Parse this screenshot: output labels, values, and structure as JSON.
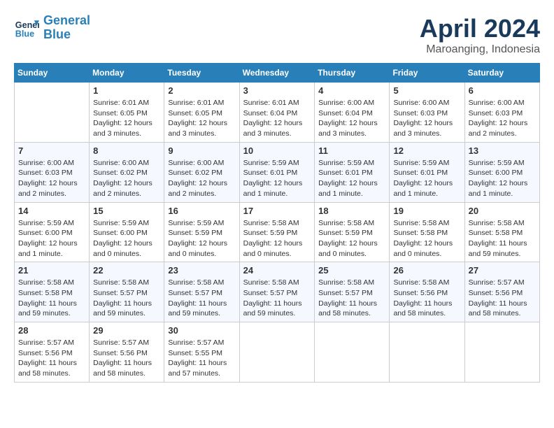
{
  "header": {
    "logo_line1": "General",
    "logo_line2": "Blue",
    "month": "April 2024",
    "location": "Maroanging, Indonesia"
  },
  "weekdays": [
    "Sunday",
    "Monday",
    "Tuesday",
    "Wednesday",
    "Thursday",
    "Friday",
    "Saturday"
  ],
  "weeks": [
    [
      {
        "day": "",
        "empty": true
      },
      {
        "day": "1",
        "sunrise": "6:01 AM",
        "sunset": "6:05 PM",
        "daylight": "12 hours and 3 minutes."
      },
      {
        "day": "2",
        "sunrise": "6:01 AM",
        "sunset": "6:05 PM",
        "daylight": "12 hours and 3 minutes."
      },
      {
        "day": "3",
        "sunrise": "6:01 AM",
        "sunset": "6:04 PM",
        "daylight": "12 hours and 3 minutes."
      },
      {
        "day": "4",
        "sunrise": "6:00 AM",
        "sunset": "6:04 PM",
        "daylight": "12 hours and 3 minutes."
      },
      {
        "day": "5",
        "sunrise": "6:00 AM",
        "sunset": "6:03 PM",
        "daylight": "12 hours and 3 minutes."
      },
      {
        "day": "6",
        "sunrise": "6:00 AM",
        "sunset": "6:03 PM",
        "daylight": "12 hours and 2 minutes."
      }
    ],
    [
      {
        "day": "7",
        "sunrise": "6:00 AM",
        "sunset": "6:03 PM",
        "daylight": "12 hours and 2 minutes."
      },
      {
        "day": "8",
        "sunrise": "6:00 AM",
        "sunset": "6:02 PM",
        "daylight": "12 hours and 2 minutes."
      },
      {
        "day": "9",
        "sunrise": "6:00 AM",
        "sunset": "6:02 PM",
        "daylight": "12 hours and 2 minutes."
      },
      {
        "day": "10",
        "sunrise": "5:59 AM",
        "sunset": "6:01 PM",
        "daylight": "12 hours and 1 minute."
      },
      {
        "day": "11",
        "sunrise": "5:59 AM",
        "sunset": "6:01 PM",
        "daylight": "12 hours and 1 minute."
      },
      {
        "day": "12",
        "sunrise": "5:59 AM",
        "sunset": "6:01 PM",
        "daylight": "12 hours and 1 minute."
      },
      {
        "day": "13",
        "sunrise": "5:59 AM",
        "sunset": "6:00 PM",
        "daylight": "12 hours and 1 minute."
      }
    ],
    [
      {
        "day": "14",
        "sunrise": "5:59 AM",
        "sunset": "6:00 PM",
        "daylight": "12 hours and 1 minute."
      },
      {
        "day": "15",
        "sunrise": "5:59 AM",
        "sunset": "6:00 PM",
        "daylight": "12 hours and 0 minutes."
      },
      {
        "day": "16",
        "sunrise": "5:59 AM",
        "sunset": "5:59 PM",
        "daylight": "12 hours and 0 minutes."
      },
      {
        "day": "17",
        "sunrise": "5:58 AM",
        "sunset": "5:59 PM",
        "daylight": "12 hours and 0 minutes."
      },
      {
        "day": "18",
        "sunrise": "5:58 AM",
        "sunset": "5:59 PM",
        "daylight": "12 hours and 0 minutes."
      },
      {
        "day": "19",
        "sunrise": "5:58 AM",
        "sunset": "5:58 PM",
        "daylight": "12 hours and 0 minutes."
      },
      {
        "day": "20",
        "sunrise": "5:58 AM",
        "sunset": "5:58 PM",
        "daylight": "11 hours and 59 minutes."
      }
    ],
    [
      {
        "day": "21",
        "sunrise": "5:58 AM",
        "sunset": "5:58 PM",
        "daylight": "11 hours and 59 minutes."
      },
      {
        "day": "22",
        "sunrise": "5:58 AM",
        "sunset": "5:57 PM",
        "daylight": "11 hours and 59 minutes."
      },
      {
        "day": "23",
        "sunrise": "5:58 AM",
        "sunset": "5:57 PM",
        "daylight": "11 hours and 59 minutes."
      },
      {
        "day": "24",
        "sunrise": "5:58 AM",
        "sunset": "5:57 PM",
        "daylight": "11 hours and 59 minutes."
      },
      {
        "day": "25",
        "sunrise": "5:58 AM",
        "sunset": "5:57 PM",
        "daylight": "11 hours and 58 minutes."
      },
      {
        "day": "26",
        "sunrise": "5:58 AM",
        "sunset": "5:56 PM",
        "daylight": "11 hours and 58 minutes."
      },
      {
        "day": "27",
        "sunrise": "5:57 AM",
        "sunset": "5:56 PM",
        "daylight": "11 hours and 58 minutes."
      }
    ],
    [
      {
        "day": "28",
        "sunrise": "5:57 AM",
        "sunset": "5:56 PM",
        "daylight": "11 hours and 58 minutes."
      },
      {
        "day": "29",
        "sunrise": "5:57 AM",
        "sunset": "5:56 PM",
        "daylight": "11 hours and 58 minutes."
      },
      {
        "day": "30",
        "sunrise": "5:57 AM",
        "sunset": "5:55 PM",
        "daylight": "11 hours and 57 minutes."
      },
      {
        "day": "",
        "empty": true
      },
      {
        "day": "",
        "empty": true
      },
      {
        "day": "",
        "empty": true
      },
      {
        "day": "",
        "empty": true
      }
    ]
  ]
}
